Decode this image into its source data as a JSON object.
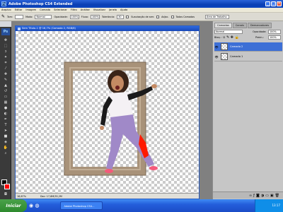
{
  "window": {
    "title": "Adobe Photoshop CS4 Extended",
    "app_icon": "Ps"
  },
  "menu": [
    "Arquivo",
    "Editar",
    "Imagem",
    "Camada",
    "Selecionar",
    "Filtro",
    "Análise",
    "Visualizar",
    "Janela",
    "Ajuda"
  ],
  "options": {
    "size_label": "Tam:",
    "mode_label": "Modo:",
    "mode_value": "Normal",
    "opacity_label": "Opacidade:",
    "opacity_value": "100%",
    "flow_label": "Fluxo:",
    "flow_value": "100%",
    "tolerance_label": "Tolerância:",
    "tolerance_value": "30",
    "antialias_label": "Suavização de serr.",
    "contiguous_label": "Adjac.",
    "all_layers_label": "Todas Camadas",
    "workspace_label": "Área de Trabalho"
  },
  "document": {
    "tab_title": "Sem Título-1 @ 16,7% (Camada 2, RGB/8)",
    "zoom": "16,67%",
    "doc_info": "Doc: 17,6M/35,2M"
  },
  "layers_panel": {
    "tabs": [
      "Camadas",
      "Canais",
      "Demarcadores"
    ],
    "blend_mode": "Normal",
    "opacity_label": "Opacidade:",
    "opacity_value": "100%",
    "lock_label": "Bloq.:",
    "fill_label": "Preen.:",
    "fill_value": "100%",
    "layers": [
      {
        "name": "Camada 2",
        "selected": true
      },
      {
        "name": "Camada 1",
        "selected": false
      }
    ]
  },
  "taskbar": {
    "start_label": "Iniciar",
    "task_label": "Adobe Photoshop CS4...",
    "time": "13:17"
  },
  "colors": {
    "accent": "#2a63d8",
    "selection": "#3d6fd6",
    "foreground": "#000000",
    "background_swatch": "#ff0000",
    "frame": "#a89279"
  }
}
